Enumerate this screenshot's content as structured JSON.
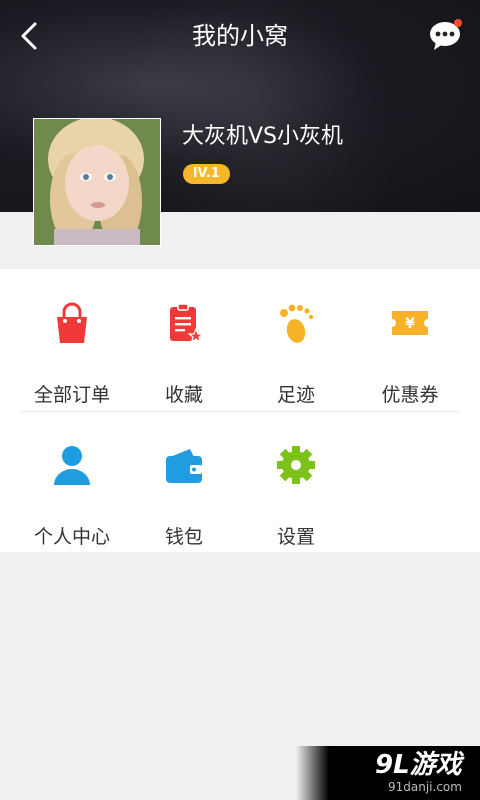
{
  "header": {
    "title": "我的小窝"
  },
  "profile": {
    "username": "大灰机VS小灰机",
    "level": "lV.1"
  },
  "menu": {
    "row1": [
      {
        "label": "全部订单",
        "icon": "shopping-bag-icon",
        "color": "#f03a3a"
      },
      {
        "label": "收藏",
        "icon": "favorites-clipboard-icon",
        "color": "#f03a3a"
      },
      {
        "label": "足迹",
        "icon": "footprint-icon",
        "color": "#f8b22a"
      },
      {
        "label": "优惠券",
        "icon": "coupon-icon",
        "color": "#f8b22a"
      }
    ],
    "row2": [
      {
        "label": "个人中心",
        "icon": "user-icon",
        "color": "#1f9de0"
      },
      {
        "label": "钱包",
        "icon": "wallet-icon",
        "color": "#1f9de0"
      },
      {
        "label": "设置",
        "icon": "gear-icon",
        "color": "#7cc21a"
      }
    ]
  },
  "watermark": {
    "title": "9L游戏",
    "url": "91danji.com"
  }
}
